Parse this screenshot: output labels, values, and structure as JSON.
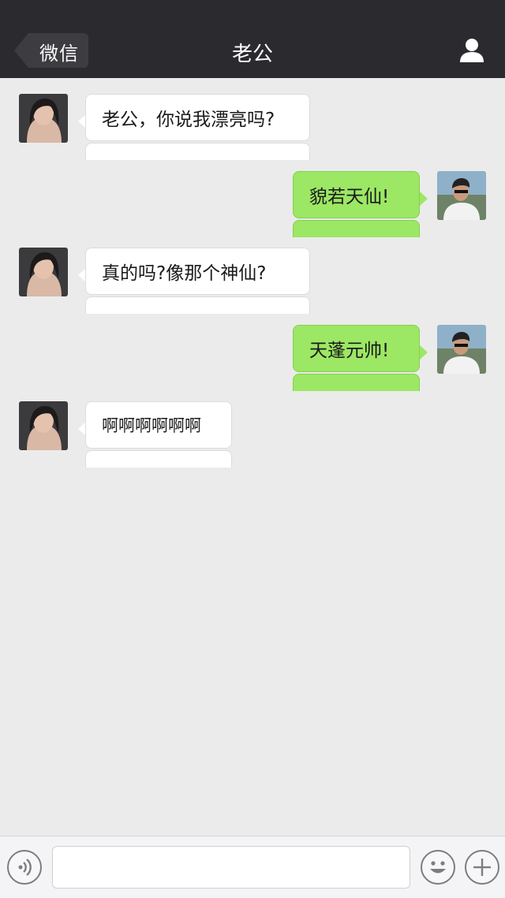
{
  "header": {
    "back_label": "微信",
    "title": "老公"
  },
  "messages": [
    {
      "side": "in",
      "text": "老公，你说我漂亮吗?"
    },
    {
      "side": "out",
      "text": "貌若天仙!"
    },
    {
      "side": "in",
      "text": "真的吗?像那个神仙?"
    },
    {
      "side": "out",
      "text": "天蓬元帅!"
    },
    {
      "side": "in",
      "text": "啊啊啊啊啊啊"
    }
  ],
  "input": {
    "placeholder": "",
    "value": ""
  },
  "colors": {
    "header_bg": "#2b2a2e",
    "chat_bg": "#ebebeb",
    "out_bubble": "#9ce764",
    "in_bubble": "#ffffff"
  },
  "icons": {
    "back": "chevron-left-icon",
    "profile": "person-icon",
    "voice": "voice-icon",
    "emoji": "smiley-icon",
    "more": "plus-icon"
  }
}
